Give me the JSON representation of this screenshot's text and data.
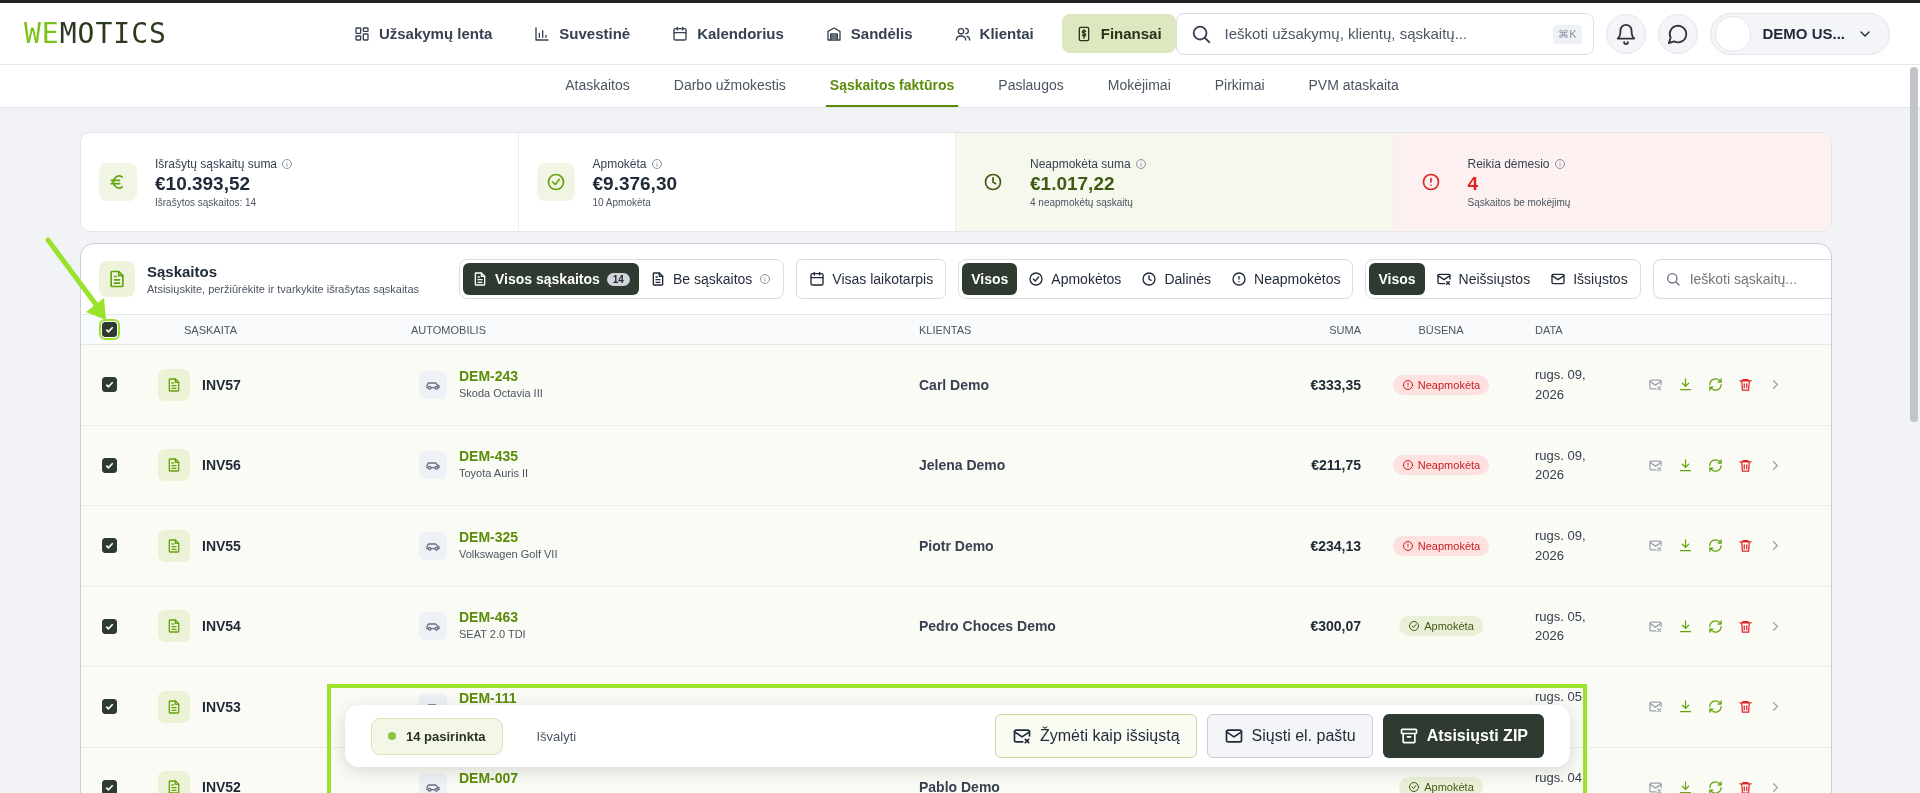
{
  "brand": {
    "accent": "WE",
    "rest": "MOTICS"
  },
  "nav": [
    {
      "label": "Užsakymų lenta",
      "selected": false
    },
    {
      "label": "Suvestinė",
      "selected": false
    },
    {
      "label": "Kalendorius",
      "selected": false
    },
    {
      "label": "Sandėlis",
      "selected": false
    },
    {
      "label": "Klientai",
      "selected": false
    },
    {
      "label": "Finansai",
      "selected": true
    }
  ],
  "search": {
    "placeholder": "Ieškoti užsakymų, klientų, sąskaitų...",
    "shortcut": "⌘K"
  },
  "user": {
    "name": "DEMO US..."
  },
  "subnav": [
    {
      "label": "Ataskaitos",
      "selected": false
    },
    {
      "label": "Darbo užmokestis",
      "selected": false
    },
    {
      "label": "Sąskaitos faktūros",
      "selected": true
    },
    {
      "label": "Paslaugos",
      "selected": false
    },
    {
      "label": "Mokėjimai",
      "selected": false
    },
    {
      "label": "Pirkimai",
      "selected": false
    },
    {
      "label": "PVM ataskaita",
      "selected": false
    }
  ],
  "stats": [
    {
      "kind": "total",
      "label": "Išrašytų sąskaitų suma",
      "value": "€10.393,52",
      "note": "Išrašytos sąskaitos: 14"
    },
    {
      "kind": "paid",
      "label": "Apmokėta",
      "value": "€9.376,30",
      "note": "10 Apmokėta"
    },
    {
      "kind": "unpaid",
      "label": "Neapmokėta suma",
      "value": "€1.017,22",
      "note": "4 neapmokėtų sąskaitų"
    },
    {
      "kind": "attention",
      "label": "Reikia dėmesio",
      "value": "4",
      "note": "Sąskaitos be mokėjimų"
    }
  ],
  "invoices": {
    "title": "Sąskaitos",
    "subtitle": "Atsisiųskite, peržiūrėkite ir tvarkykite išrašytas sąskaitas",
    "type_filter": [
      {
        "label": "Visos sąskaitos",
        "count": "14",
        "selected": true
      },
      {
        "label": "Be sąskaitos",
        "selected": false
      }
    ],
    "period": "Visas laikotarpis",
    "payment_filter": [
      {
        "label": "Visos",
        "selected": true
      },
      {
        "label": "Apmokėtos",
        "selected": false
      },
      {
        "label": "Dalinės",
        "selected": false
      },
      {
        "label": "Neapmokėtos",
        "selected": false
      }
    ],
    "send_filter": [
      {
        "label": "Visos",
        "selected": true
      },
      {
        "label": "Neišsiųstos",
        "selected": false
      },
      {
        "label": "Išsiųstos",
        "selected": false
      }
    ],
    "search_placeholder": "Ieškoti sąskaitų...",
    "select_all": true,
    "columns": [
      "SĄSKAITA",
      "AUTOMOBILIS",
      "KLIENTAS",
      "SUMA",
      "BŪSENA",
      "DATA"
    ],
    "rows": [
      {
        "checked": true,
        "invoice": "INV57",
        "plate": "DEM-243",
        "car": "Skoda Octavia III",
        "client": "Carl Demo",
        "amount": "€333,35",
        "status": {
          "kind": "unpaid",
          "label": "Neapmokėta"
        },
        "date": "rugs. 09, 2026"
      },
      {
        "checked": true,
        "invoice": "INV56",
        "plate": "DEM-435",
        "car": "Toyota Auris II",
        "client": "Jelena Demo",
        "amount": "€211,75",
        "status": {
          "kind": "unpaid",
          "label": "Neapmokėta"
        },
        "date": "rugs. 09, 2026"
      },
      {
        "checked": true,
        "invoice": "INV55",
        "plate": "DEM-325",
        "car": "Volkswagen Golf VII",
        "client": "Piotr Demo",
        "amount": "€234,13",
        "status": {
          "kind": "unpaid",
          "label": "Neapmokėta"
        },
        "date": "rugs. 09, 2026"
      },
      {
        "checked": true,
        "invoice": "INV54",
        "plate": "DEM-463",
        "car": "SEAT 2.0 TDI",
        "client": "Pedro Choces Demo",
        "amount": "€300,07",
        "status": {
          "kind": "paid",
          "label": "Apmokėta"
        },
        "date": "rugs. 05, 2026"
      },
      {
        "checked": true,
        "invoice": "INV53",
        "plate": "DEM-111",
        "date": "rugs. 05"
      },
      {
        "checked": true,
        "invoice": "INV52",
        "plate": "DEM-007",
        "client": "Pablo Demo",
        "status": {
          "kind": "paid",
          "label": "Apmokėta"
        },
        "date": "rugs. 04"
      }
    ]
  },
  "bulk_bar": {
    "count": "14 pasirinkta",
    "clear": "Išvalyti",
    "actions": [
      {
        "kind": "mark",
        "label": "Žymėti kaip išsiųstą"
      },
      {
        "kind": "send",
        "label": "Siųsti el. paštu"
      },
      {
        "kind": "zip",
        "label": "Atsisiųsti ZIP"
      }
    ]
  }
}
